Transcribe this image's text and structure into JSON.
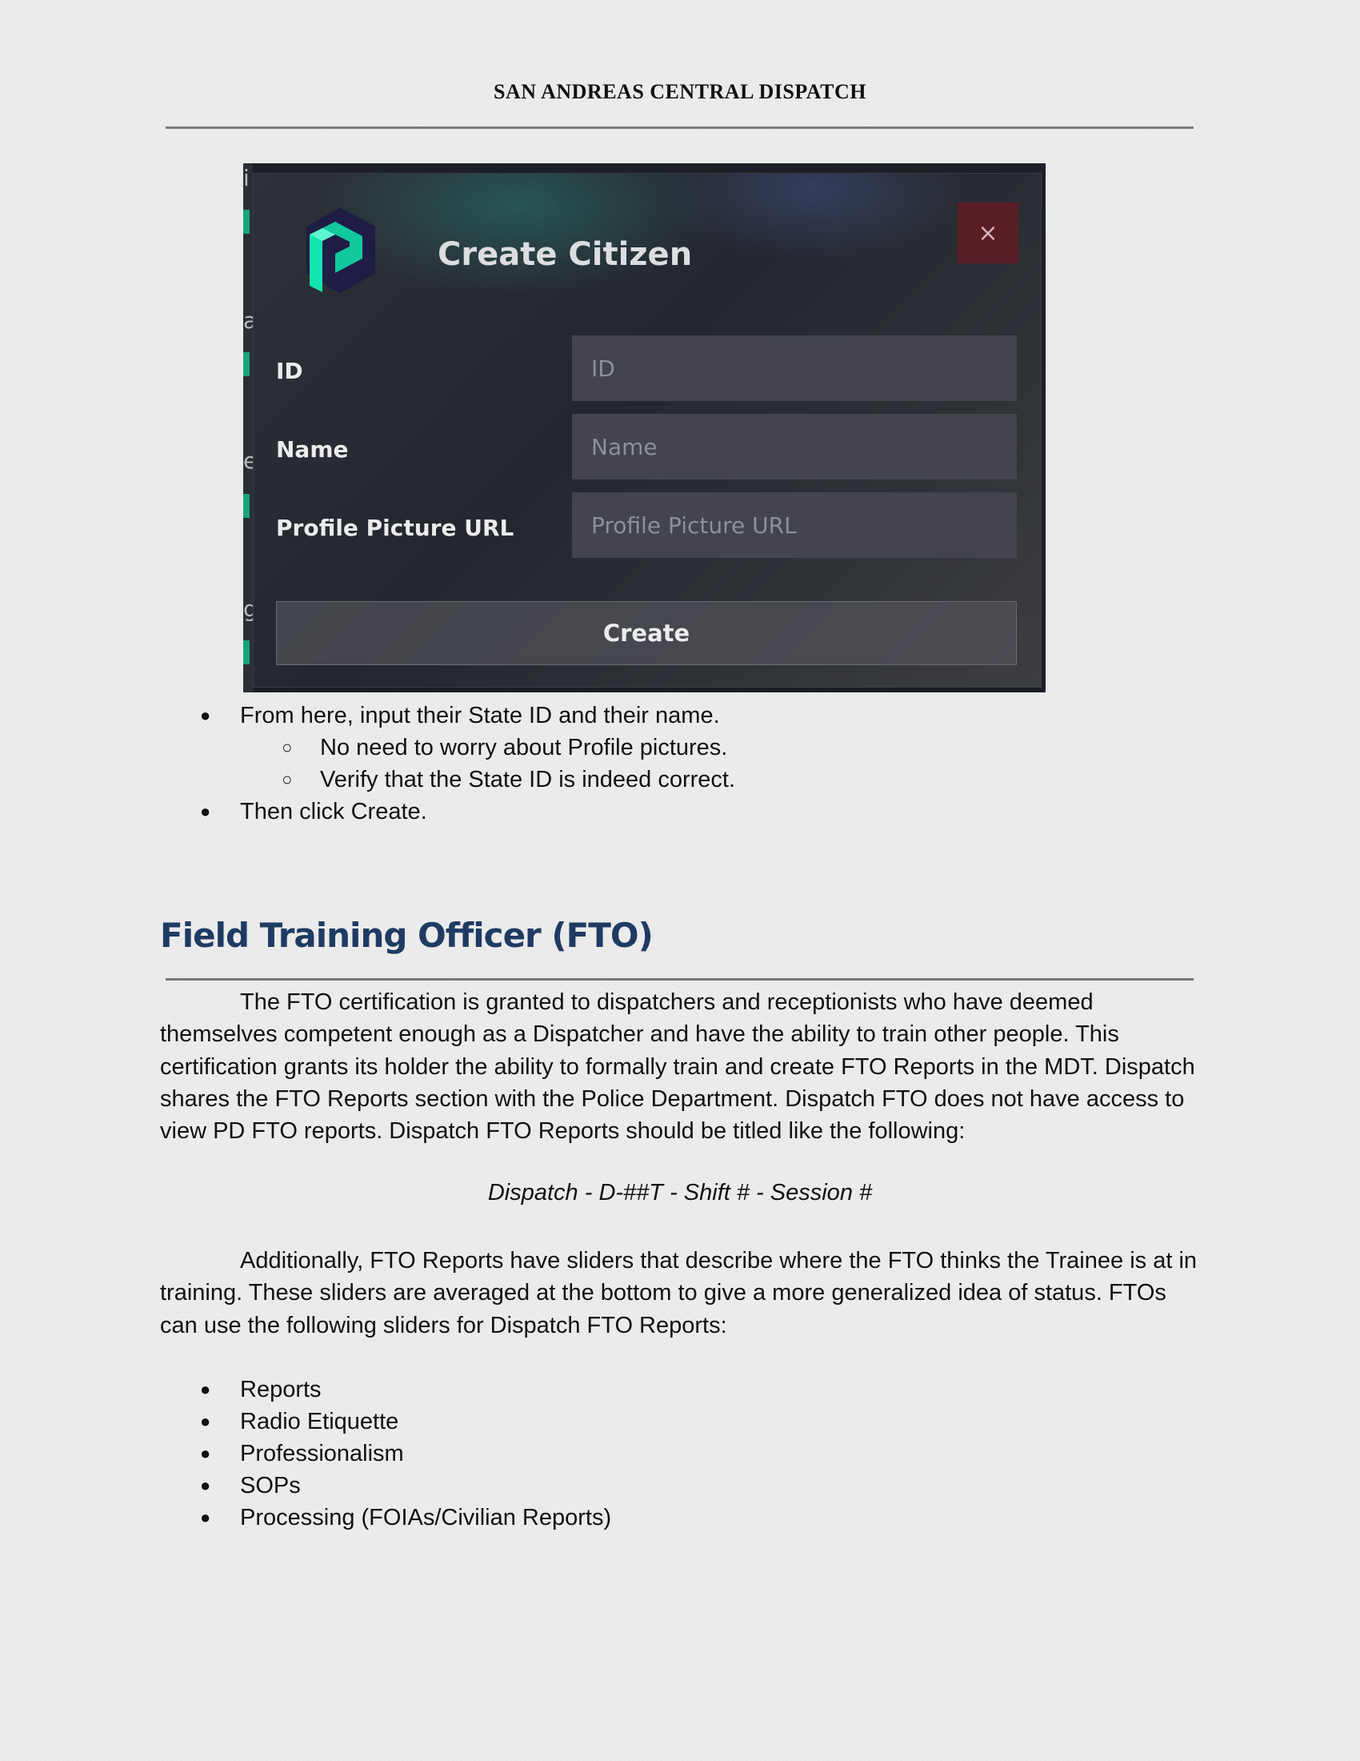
{
  "header": {
    "title": "SAN ANDREAS CENTRAL DISPATCH"
  },
  "dialog": {
    "title": "Create Citizen",
    "close_label": "×",
    "fields": [
      {
        "label": "ID",
        "placeholder": "ID"
      },
      {
        "label": "Name",
        "placeholder": "Name"
      },
      {
        "label": "Profile Picture URL",
        "placeholder": "Profile Picture URL"
      }
    ],
    "create_label": "Create",
    "background_letters": [
      "i",
      "a",
      "e",
      "g"
    ]
  },
  "steps": {
    "item1": "From here, input their State ID and their name.",
    "sub1": "No need to worry about Profile pictures.",
    "sub2": "Verify that the State ID is indeed correct.",
    "item2": "Then click Create."
  },
  "fto": {
    "heading": "Field Training Officer (FTO)",
    "paragraph1": "The FTO certification is granted to dispatchers and receptionists who have deemed themselves competent enough as a Dispatcher and have the ability to train other people. This certification grants its holder the ability to formally train and create FTO Reports in the MDT. Dispatch shares the FTO Reports section with the Police Department. Dispatch FTO does not have access to view PD FTO reports. Dispatch FTO Reports should be titled like the following:",
    "title_format": "Dispatch - D-##T - Shift # - Session #",
    "paragraph2": "Additionally, FTO Reports have sliders that describe where the FTO thinks the Trainee is at in training. These sliders are averaged at the bottom to give a more generalized idea of status. FTOs can use the following sliders for Dispatch FTO Reports:",
    "sliders": [
      "Reports",
      "Radio Etiquette",
      "Professionalism",
      "SOPs",
      "Processing (FOIAs/Civilian Reports)"
    ]
  },
  "colors": {
    "heading": "#1f3b63",
    "logo_accent": "#14e3b2",
    "close_bg": "#5a1d25"
  }
}
